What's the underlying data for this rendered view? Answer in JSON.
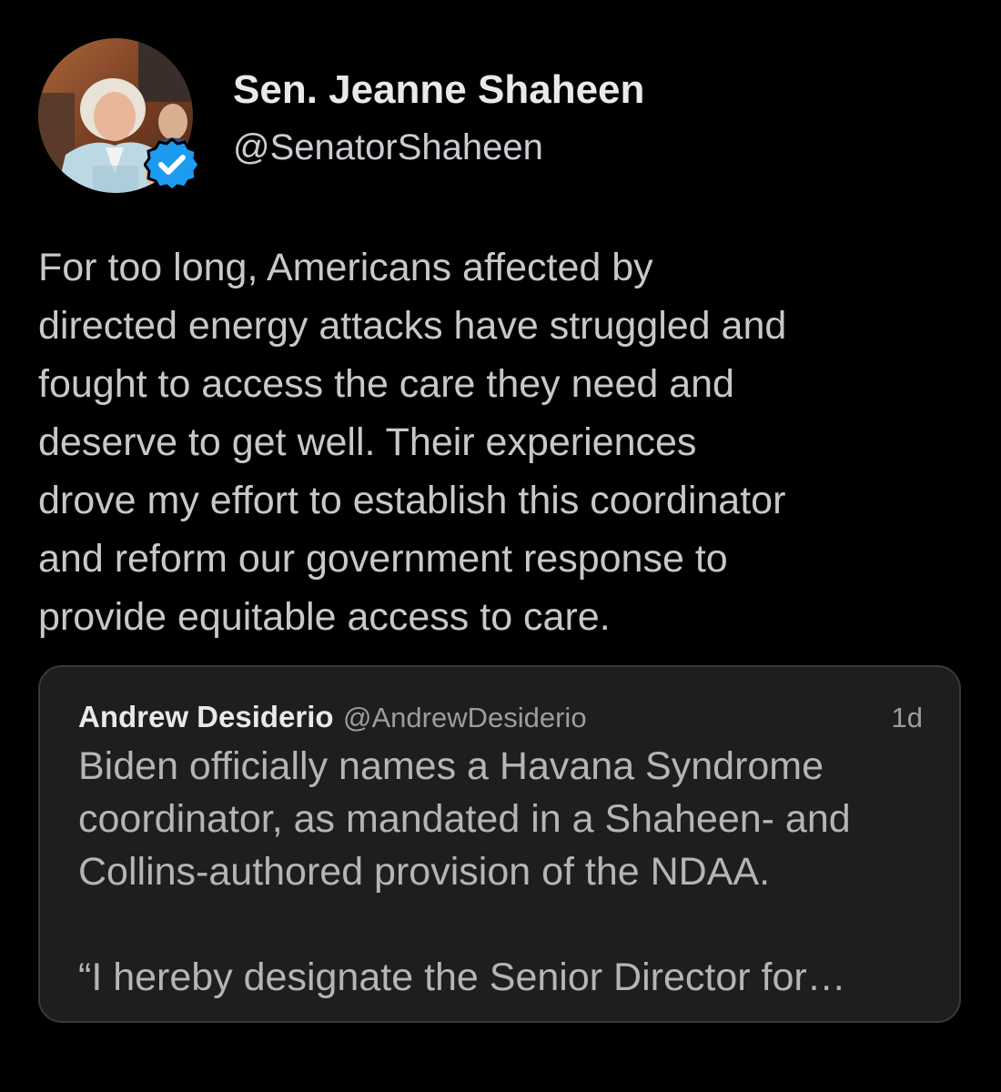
{
  "tweet": {
    "author": {
      "name": "Sen. Jeanne Shaheen",
      "handle": "@SenatorShaheen",
      "verified": true,
      "verified_color": "#1d9bf0"
    },
    "text": "For too long, Americans affected by\ndirected energy attacks have struggled and\nfought to access the care they need and\ndeserve to get well. Their experiences\ndrove my effort to establish this coordinator\nand reform our government response to\nprovide equitable access to care.",
    "quoted_tweet": {
      "author_name": "Andrew Desiderio",
      "author_handle": "@AndrewDesiderio",
      "time": "1d",
      "text": "Biden officially names a Havana Syndrome\ncoordinator, as mandated in a Shaheen- and\nCollins-authored provision of the NDAA.\n\n“I hereby designate the Senior Director for…"
    }
  },
  "colors": {
    "background": "#000000",
    "card_background": "#1e1e1e",
    "card_border": "#3a3a3a"
  },
  "icons": {
    "avatar": "profile-photo",
    "verified": "verified-badge-icon"
  }
}
